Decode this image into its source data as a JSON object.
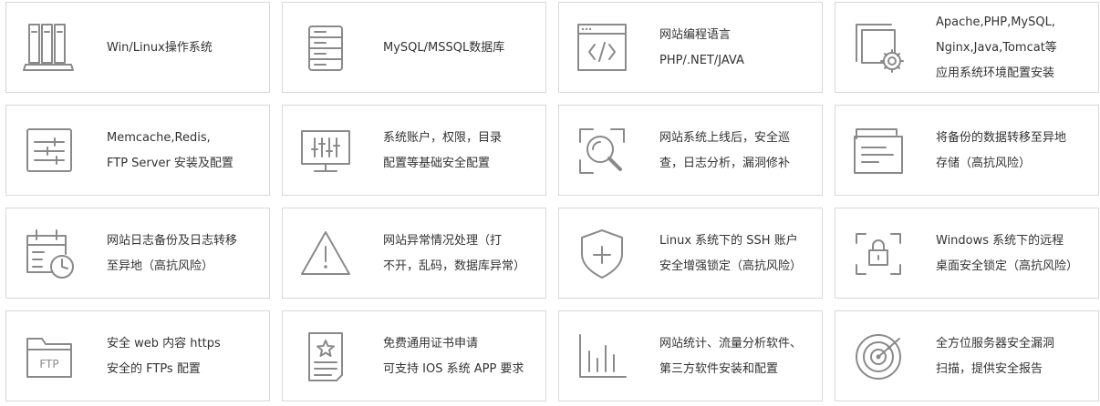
{
  "cards": [
    {
      "icon": "server-rack-icon",
      "lines": [
        "Win/Linux操作系统"
      ]
    },
    {
      "icon": "database-icon",
      "lines": [
        "MySQL/MSSQL数据库"
      ]
    },
    {
      "icon": "code-window-icon",
      "lines": [
        "网站编程语言",
        "PHP/.NET/JAVA"
      ]
    },
    {
      "icon": "settings-windows-icon",
      "lines": [
        "Apache,PHP,MySQL,",
        "Nginx,Java,Tomcat等",
        "应用系统环境配置安装"
      ]
    },
    {
      "icon": "sliders-box-icon",
      "lines": [
        "Memcache,Redis,",
        "FTP Server 安装及配置"
      ]
    },
    {
      "icon": "monitor-equalizer-icon",
      "lines": [
        "系统账户，权限，目录",
        "配置等基础安全配置"
      ]
    },
    {
      "icon": "inspection-magnifier-icon",
      "lines": [
        "网站系统上线后，安全巡",
        "查，日志分析，漏洞修补"
      ]
    },
    {
      "icon": "backup-transfer-icon",
      "lines": [
        "将备份的数据转移至异地",
        "存储（高抗风险）"
      ]
    },
    {
      "icon": "calendar-clock-icon",
      "lines": [
        "网站日志备份及日志转移",
        "至异地（高抗风险）"
      ]
    },
    {
      "icon": "warning-triangle-icon",
      "lines": [
        "网站异常情况处理（打",
        "不开，乱码，数据库异常）"
      ]
    },
    {
      "icon": "shield-plus-icon",
      "lines": [
        "Linux 系统下的 SSH 账户",
        "安全增强锁定（高抗风险）"
      ]
    },
    {
      "icon": "lock-frame-icon",
      "lines": [
        "Windows 系统下的远程",
        "桌面安全锁定（高抗风险）"
      ]
    },
    {
      "icon": "ftp-folder-icon",
      "lines": [
        "安全 web 内容 https",
        "安全的 FTPs 配置"
      ]
    },
    {
      "icon": "certificate-icon",
      "lines": [
        "免费通用证书申请",
        "可支持 IOS 系统 APP 要求"
      ]
    },
    {
      "icon": "bar-chart-icon",
      "lines": [
        "网站统计、流量分析软件、",
        "第三方软件安装和配置"
      ]
    },
    {
      "icon": "radar-scan-icon",
      "lines": [
        "全方位服务器安全漏洞",
        "扫描，提供安全报告"
      ]
    }
  ],
  "icon_ftp_text": "FTP",
  "colors": {
    "icon": "#8a8a8a",
    "border": "#d8d8d8",
    "text": "#333333"
  }
}
